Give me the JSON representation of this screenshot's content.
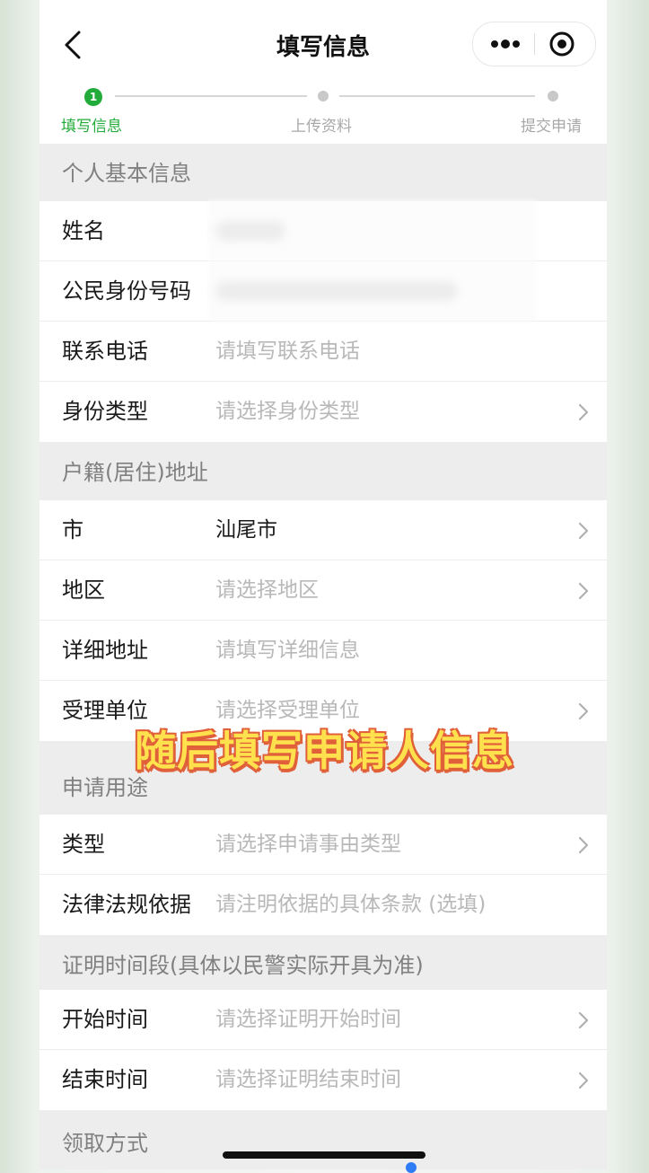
{
  "navbar": {
    "title": "填写信息"
  },
  "steps": [
    {
      "number": "1",
      "label": "填写信息",
      "active": true
    },
    {
      "label": "上传资料",
      "active": false
    },
    {
      "label": "提交申请",
      "active": false
    }
  ],
  "sections": [
    {
      "title": "个人基本信息",
      "rows": [
        {
          "label": "姓名",
          "value": "",
          "placeholder": "",
          "arrow": false,
          "blurred": true
        },
        {
          "label": "公民身份号码",
          "value": "",
          "placeholder": "",
          "arrow": false,
          "blurred": true
        },
        {
          "label": "联系电话",
          "value": "",
          "placeholder": "请填写联系电话",
          "arrow": false
        },
        {
          "label": "身份类型",
          "value": "",
          "placeholder": "请选择身份类型",
          "arrow": true
        }
      ]
    },
    {
      "title": "户籍(居住)地址",
      "rows": [
        {
          "label": "市",
          "value": "汕尾市",
          "placeholder": "",
          "arrow": true
        },
        {
          "label": "地区",
          "value": "",
          "placeholder": "请选择地区",
          "arrow": true
        },
        {
          "label": "详细地址",
          "value": "",
          "placeholder": "请填写详细信息",
          "arrow": false
        },
        {
          "label": "受理单位",
          "value": "",
          "placeholder": "请选择受理单位",
          "arrow": true
        }
      ]
    },
    {
      "title": "申请用途",
      "rows": [
        {
          "label": "类型",
          "value": "",
          "placeholder": "请选择申请事由类型",
          "arrow": true
        },
        {
          "label": "法律法规依据",
          "value": "",
          "placeholder": "请注明依据的具体条款 (选填)",
          "arrow": false
        }
      ]
    },
    {
      "title": "证明时间段(具体以民警实际开具为准)",
      "rows": [
        {
          "label": "开始时间",
          "value": "",
          "placeholder": "请选择证明开始时间",
          "arrow": true
        },
        {
          "label": "结束时间",
          "value": "",
          "placeholder": "请选择证明结束时间",
          "arrow": true
        }
      ]
    },
    {
      "title": "领取方式",
      "rows": []
    }
  ],
  "overlay_caption": "随后填写申请人信息",
  "colors": {
    "accent": "#22ab3a",
    "caption": "#ffe14d",
    "caption_outline": "#e0603a"
  },
  "icons": {
    "back": "chevron-left-icon",
    "more": "more-dots-icon",
    "close": "target-close-icon",
    "arrow": "chevron-right-icon"
  }
}
